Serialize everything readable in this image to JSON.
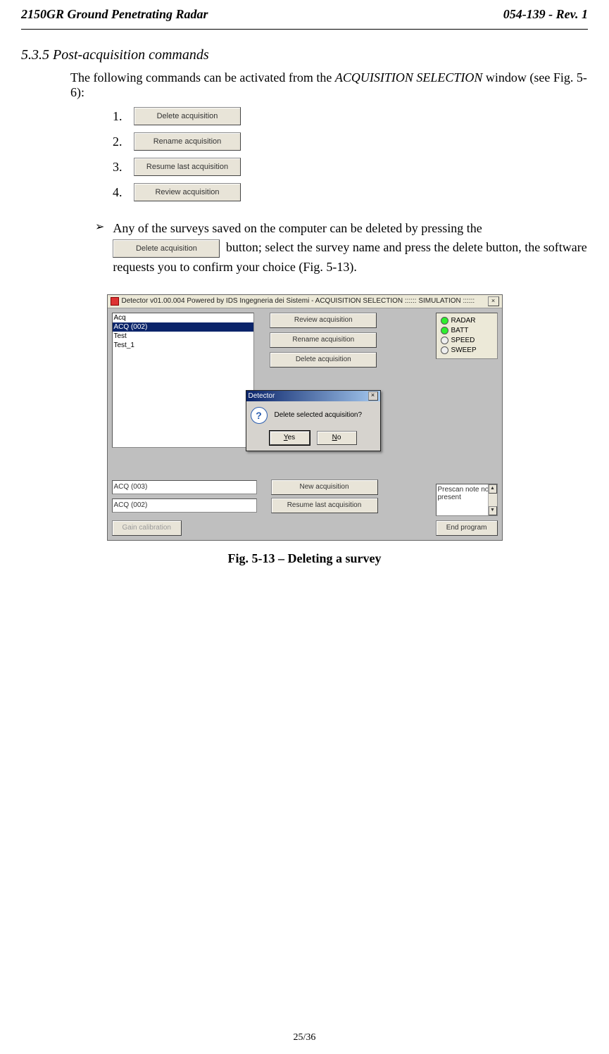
{
  "header": {
    "left": "2150GR Ground Penetrating Radar",
    "right": "054-139 - Rev. 1"
  },
  "section": "5.3.5 Post-acquisition commands",
  "intro_pre": "The following commands can be activated from the ",
  "intro_acq": "ACQUISITION SELECTION",
  "intro_post": " window (see Fig. 5-6):",
  "buttons": {
    "delete": "Delete acquisition",
    "rename": "Rename acquisition",
    "resume": "Resume last acquisition",
    "review": "Review acquisition"
  },
  "numlist": [
    "1.",
    "2.",
    "3.",
    "4."
  ],
  "bullet": {
    "line1": "Any of the surveys saved on the computer can be deleted by pressing the",
    "after_btn": " button; select the survey name and press the delete button, the software requests you to confirm your choice (Fig. 5-13)."
  },
  "fig": {
    "titlebar": "Detector v01.00.004 Powered by IDS Ingegneria dei Sistemi - ACQUISITION SELECTION :::::: SIMULATION ::::::",
    "list": {
      "items": [
        "Acq",
        "ACQ (002)",
        "Test",
        "Test_1"
      ],
      "selected_index": 1
    },
    "main_buttons": {
      "review": "Review acquisition",
      "rename": "Rename acquisition",
      "delete": "Delete acquisition"
    },
    "dialog": {
      "title": "Detector",
      "message": "Delete selected acquisition?",
      "yes": "Yes",
      "no": "No"
    },
    "bottom": {
      "field1": "ACQ (003)",
      "btn1": "New acquisition",
      "field2": "ACQ (002)",
      "btn2": "Resume last acquisition"
    },
    "status": {
      "radar": "RADAR",
      "batt": "BATT",
      "speed": "SPEED",
      "sweep": "SWEEP"
    },
    "note": "Prescan note not present",
    "footer": {
      "gain": "Gain calibration",
      "end": "End program"
    }
  },
  "caption": "Fig. 5-13 – Deleting a survey",
  "page_number": "25/36"
}
